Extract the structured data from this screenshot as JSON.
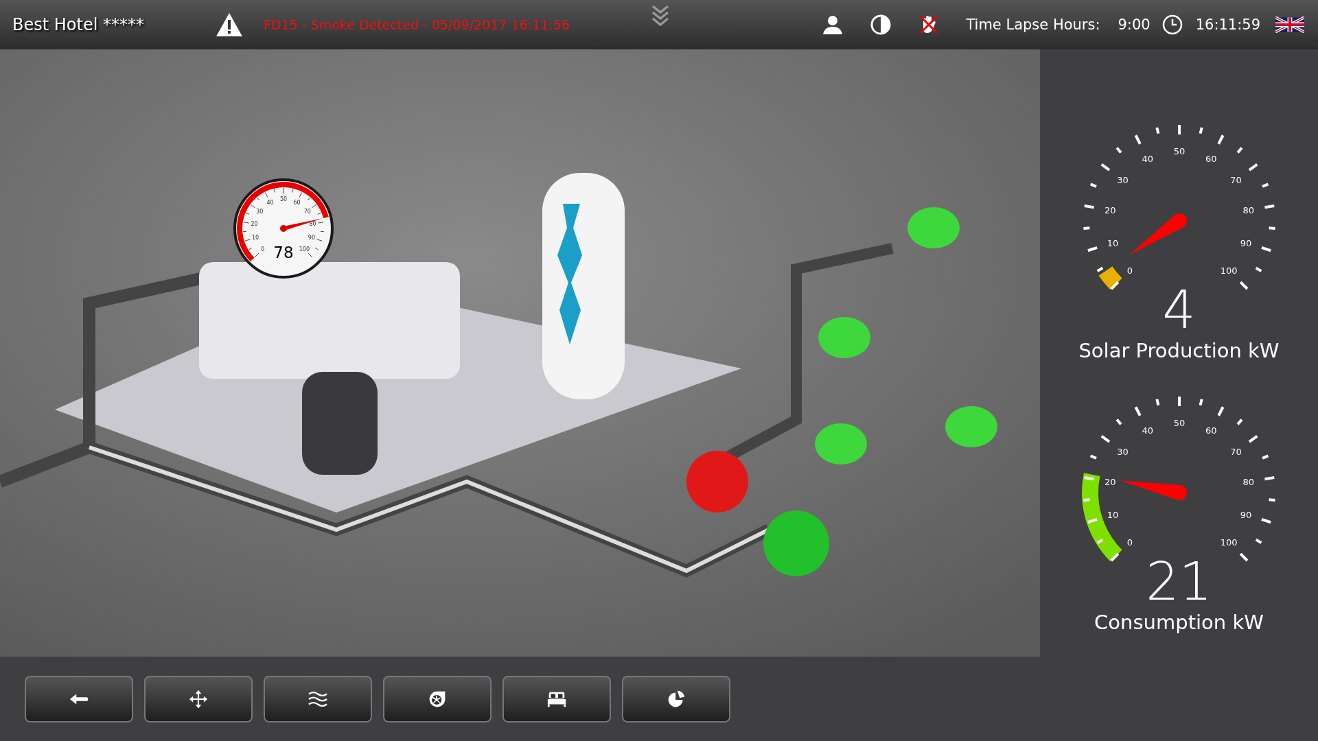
{
  "header": {
    "title": "Best Hotel *****",
    "alarm": "FD15 - Smoke Detected - 05/09/2017 16:11:56",
    "time_lapse_label": "Time Lapse Hours:",
    "time_lapse_value": "9:00",
    "clock": "16:11:59"
  },
  "scene_gauge": {
    "value": "78",
    "tick_labels": [
      "0",
      "10",
      "20",
      "30",
      "40",
      "50",
      "60",
      "70",
      "80",
      "90",
      "100"
    ]
  },
  "gauges": [
    {
      "value": "4",
      "label": "Solar Production kW",
      "color": "#e8b000",
      "tick_labels": [
        "0",
        "10",
        "20",
        "30",
        "40",
        "50",
        "60",
        "70",
        "80",
        "90",
        "100"
      ]
    },
    {
      "value": "21",
      "label": "Consumption kW",
      "color": "#7ee000",
      "tick_labels": [
        "0",
        "10",
        "20",
        "30",
        "40",
        "50",
        "60",
        "70",
        "80",
        "90",
        "100"
      ]
    }
  ]
}
